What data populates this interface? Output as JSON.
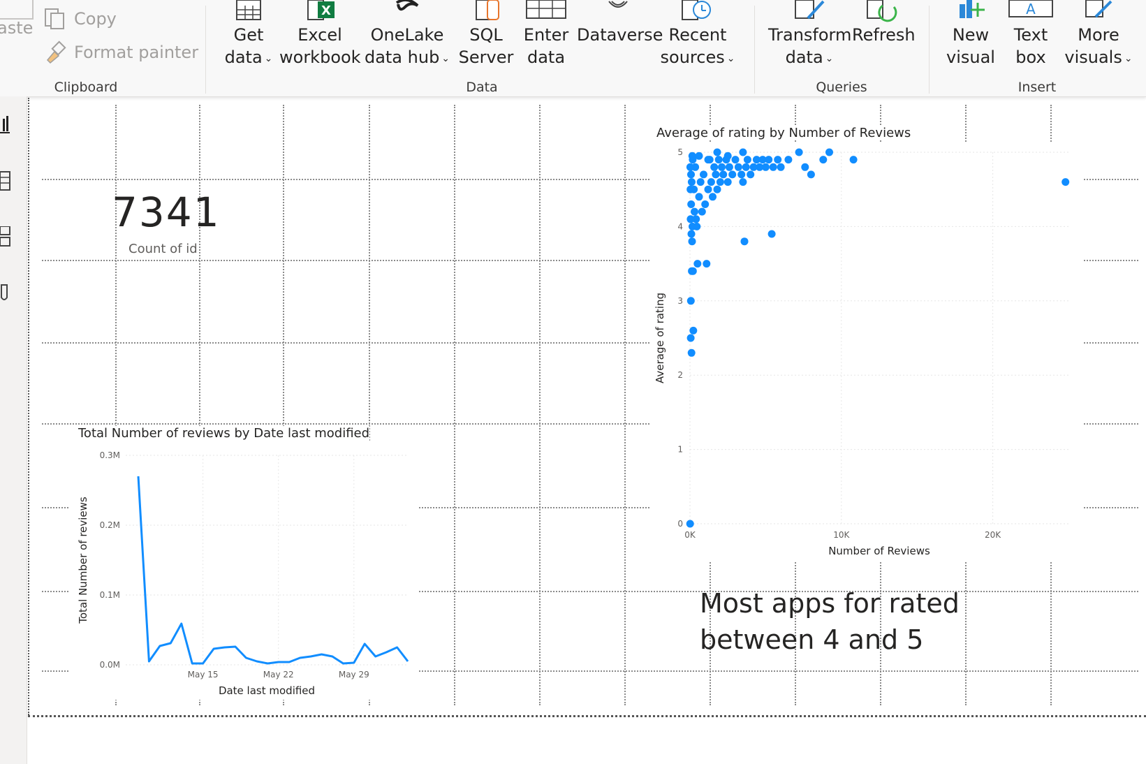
{
  "ribbon": {
    "clipboard": {
      "paste_label": "aste",
      "copy_label": "Copy",
      "format_painter_label": "Format painter",
      "group_label": "Clipboard"
    },
    "data": {
      "group_label": "Data",
      "buttons": [
        {
          "line1": "Get",
          "line2": "data",
          "has_dropdown": true,
          "icon": "table-icon"
        },
        {
          "line1": "Excel",
          "line2": "workbook",
          "has_dropdown": false,
          "icon": "excel-icon"
        },
        {
          "line1": "OneLake",
          "line2": "data hub",
          "has_dropdown": true,
          "icon": "onelake-icon"
        },
        {
          "line1": "SQL",
          "line2": "Server",
          "has_dropdown": false,
          "icon": "database-icon"
        },
        {
          "line1": "Enter",
          "line2": "data",
          "has_dropdown": false,
          "icon": "grid-icon"
        },
        {
          "line1": "Dataverse",
          "line2": "",
          "has_dropdown": false,
          "icon": "dataverse-icon"
        },
        {
          "line1": "Recent",
          "line2": "sources",
          "has_dropdown": true,
          "icon": "recent-icon"
        }
      ]
    },
    "queries": {
      "group_label": "Queries",
      "buttons": [
        {
          "line1": "Transform",
          "line2": "data",
          "has_dropdown": true,
          "icon": "transform-icon"
        },
        {
          "line1": "Refresh",
          "line2": "",
          "has_dropdown": false,
          "icon": "refresh-icon"
        }
      ]
    },
    "insert": {
      "group_label": "Insert",
      "buttons": [
        {
          "line1": "New",
          "line2": "visual",
          "has_dropdown": false,
          "icon": "new-visual-icon"
        },
        {
          "line1": "Text",
          "line2": "box",
          "has_dropdown": false,
          "icon": "text-box-icon"
        },
        {
          "line1": "More",
          "line2": "visuals",
          "has_dropdown": true,
          "icon": "more-visuals-icon"
        }
      ]
    }
  },
  "left_rail": {
    "icons": [
      "report-view-icon",
      "table-view-icon",
      "model-view-icon",
      "dax-query-icon"
    ]
  },
  "card": {
    "value": "7341",
    "label": "Count of id"
  },
  "note": {
    "line1": "Most apps for rated",
    "line2": "between 4 and 5"
  },
  "colors": {
    "accent": "#118DFF",
    "excel_green": "#107C41",
    "sql_orange": "#E8762D",
    "refresh_green": "#3BB44A",
    "icon_blue": "#2B88D8"
  },
  "chart_data": [
    {
      "type": "line",
      "title": "Total Number of reviews by Date last modified",
      "xlabel": "Date last modified",
      "ylabel": "Total Number of reviews",
      "y_ticks": [
        "0.0M",
        "0.1M",
        "0.2M",
        "0.3M"
      ],
      "ylim": [
        0,
        300000
      ],
      "x_ticks": [
        "May 15",
        "May 22",
        "May 29"
      ],
      "x": [
        "May 9",
        "May 10",
        "May 11",
        "May 12",
        "May 13",
        "May 14",
        "May 15",
        "May 16",
        "May 17",
        "May 18",
        "May 19",
        "May 20",
        "May 21",
        "May 22",
        "May 23",
        "May 24",
        "May 25",
        "May 26",
        "May 27",
        "May 28",
        "May 29",
        "May 30",
        "May 31",
        "Jun 1",
        "Jun 2",
        "Jun 3"
      ],
      "values": [
        270000,
        5000,
        27000,
        31000,
        59000,
        2000,
        2000,
        23000,
        25000,
        26000,
        10000,
        5000,
        2000,
        4000,
        4000,
        10000,
        12000,
        15000,
        12000,
        2000,
        3000,
        30000,
        12000,
        18000,
        25000,
        5000
      ],
      "grid": true,
      "color": "#118DFF"
    },
    {
      "type": "scatter",
      "title": "Average of rating by Number of Reviews",
      "xlabel": "Number of Reviews",
      "ylabel": "Average of rating",
      "x_ticks": [
        "0K",
        "10K",
        "20K"
      ],
      "y_ticks": [
        "0",
        "1",
        "2",
        "3",
        "4",
        "5"
      ],
      "xlim": [
        0,
        25000
      ],
      "ylim": [
        0,
        5
      ],
      "grid": true,
      "color": "#118DFF",
      "points": [
        [
          24800,
          4.6
        ],
        [
          10800,
          4.9
        ],
        [
          9200,
          5.0
        ],
        [
          8800,
          4.9
        ],
        [
          8000,
          4.7
        ],
        [
          7600,
          4.8
        ],
        [
          7200,
          5.0
        ],
        [
          6500,
          4.9
        ],
        [
          6000,
          4.8
        ],
        [
          5800,
          4.9
        ],
        [
          5500,
          4.8
        ],
        [
          5400,
          3.9
        ],
        [
          5200,
          4.9
        ],
        [
          5000,
          4.8
        ],
        [
          4800,
          4.9
        ],
        [
          4600,
          4.8
        ],
        [
          4400,
          4.9
        ],
        [
          4200,
          4.8
        ],
        [
          4000,
          4.7
        ],
        [
          3800,
          4.9
        ],
        [
          3700,
          4.8
        ],
        [
          3600,
          3.8
        ],
        [
          3500,
          4.6
        ],
        [
          3400,
          4.7
        ],
        [
          3200,
          4.8
        ],
        [
          3000,
          4.9
        ],
        [
          2800,
          4.7
        ],
        [
          2600,
          4.8
        ],
        [
          2500,
          4.6
        ],
        [
          2400,
          4.9
        ],
        [
          2200,
          4.7
        ],
        [
          2100,
          4.8
        ],
        [
          2000,
          4.6
        ],
        [
          1900,
          4.9
        ],
        [
          1800,
          4.5
        ],
        [
          1700,
          4.7
        ],
        [
          1600,
          4.8
        ],
        [
          1500,
          4.4
        ],
        [
          1400,
          4.6
        ],
        [
          1300,
          4.9
        ],
        [
          1200,
          4.5
        ],
        [
          1100,
          3.5
        ],
        [
          1000,
          4.3
        ],
        [
          900,
          4.7
        ],
        [
          800,
          4.2
        ],
        [
          700,
          4.6
        ],
        [
          600,
          4.4
        ],
        [
          500,
          3.5
        ],
        [
          450,
          4.0
        ],
        [
          400,
          4.1
        ],
        [
          350,
          4.8
        ],
        [
          300,
          4.2
        ],
        [
          260,
          4.5
        ],
        [
          220,
          2.6
        ],
        [
          200,
          3.4
        ],
        [
          180,
          4.9
        ],
        [
          160,
          4.0
        ],
        [
          140,
          3.8
        ],
        [
          120,
          3.4
        ],
        [
          110,
          4.6
        ],
        [
          100,
          2.3
        ],
        [
          90,
          3.9
        ],
        [
          80,
          4.3
        ],
        [
          70,
          4.7
        ],
        [
          60,
          3.0
        ],
        [
          50,
          2.5
        ],
        [
          40,
          4.1
        ],
        [
          30,
          4.5
        ],
        [
          20,
          4.8
        ],
        [
          10,
          0.0
        ],
        [
          150,
          4.95
        ],
        [
          600,
          4.95
        ],
        [
          1200,
          4.9
        ],
        [
          1800,
          5.0
        ],
        [
          2500,
          4.95
        ],
        [
          3500,
          5.0
        ]
      ]
    }
  ]
}
